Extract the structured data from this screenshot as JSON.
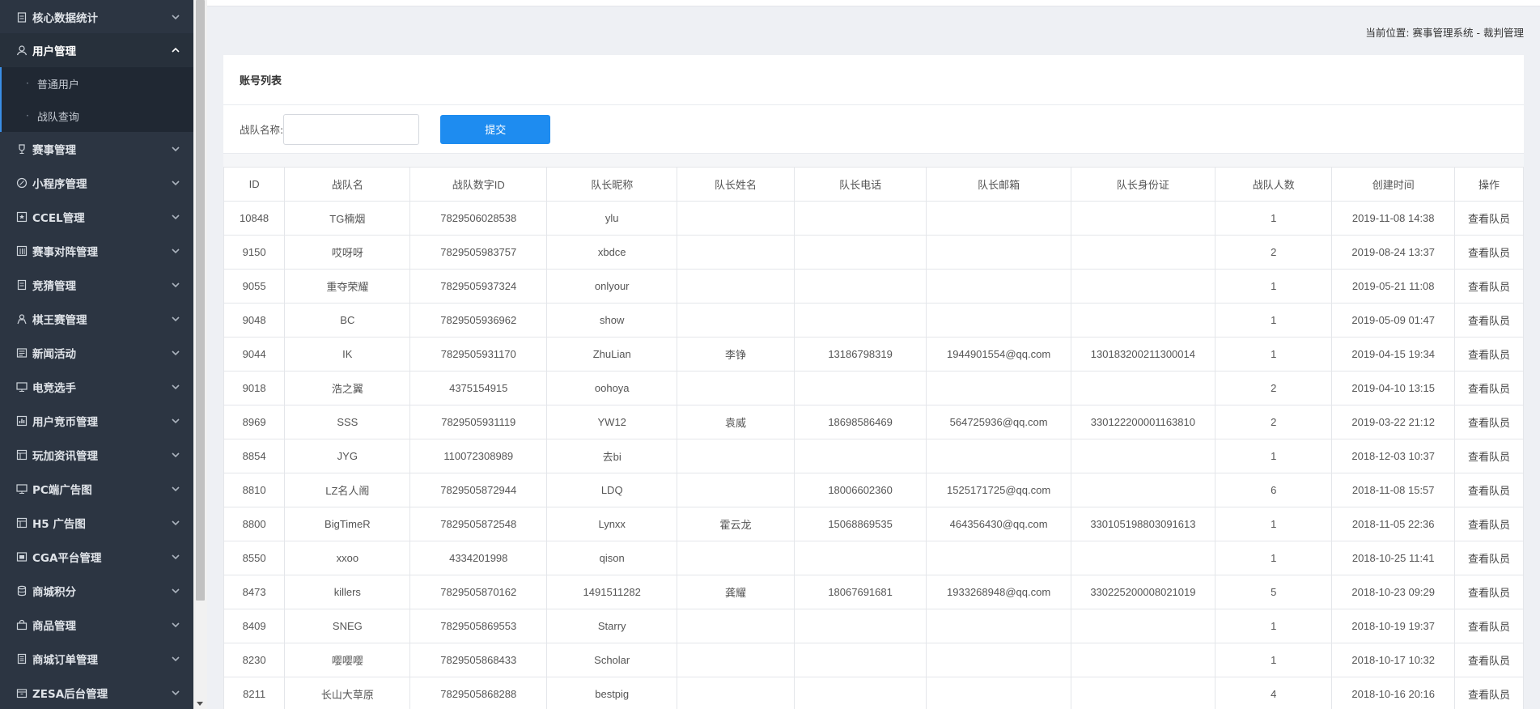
{
  "sidebar": {
    "items": [
      {
        "label": "核心数据统计",
        "icon": "clipboard-icon",
        "open": false
      },
      {
        "label": "用户管理",
        "icon": "user-icon",
        "open": true,
        "children": [
          "普通用户",
          "战队查询"
        ]
      },
      {
        "label": "赛事管理",
        "icon": "trophy-icon",
        "open": false
      },
      {
        "label": "小程序管理",
        "icon": "link-icon",
        "open": false
      },
      {
        "label": "CCEL管理",
        "icon": "star-box-icon",
        "open": false
      },
      {
        "label": "赛事对阵管理",
        "icon": "grid-icon",
        "open": false
      },
      {
        "label": "竞猜管理",
        "icon": "document-icon",
        "open": false
      },
      {
        "label": "棋王赛管理",
        "icon": "person-icon",
        "open": false
      },
      {
        "label": "新闻活动",
        "icon": "news-icon",
        "open": false
      },
      {
        "label": "电竞选手",
        "icon": "monitor-icon",
        "open": false
      },
      {
        "label": "用户竞币管理",
        "icon": "chart-icon",
        "open": false
      },
      {
        "label": "玩加资讯管理",
        "icon": "panel-icon",
        "open": false
      },
      {
        "label": "PC端广告图",
        "icon": "monitor-icon",
        "open": false
      },
      {
        "label": "H5 广告图",
        "icon": "panel-icon",
        "open": false
      },
      {
        "label": "CGA平台管理",
        "icon": "window-icon",
        "open": false
      },
      {
        "label": "商城积分",
        "icon": "database-icon",
        "open": false
      },
      {
        "label": "商品管理",
        "icon": "bag-icon",
        "open": false
      },
      {
        "label": "商城订单管理",
        "icon": "list-icon",
        "open": false
      },
      {
        "label": "ZESA后台管理",
        "icon": "box-icon",
        "open": false
      }
    ]
  },
  "breadcrumb": "当前位置: 赛事管理系统 - 裁判管理",
  "panel": {
    "title": "账号列表",
    "search_label": "战队名称:",
    "search_value": "",
    "submit_label": "提交"
  },
  "table": {
    "columns": [
      "ID",
      "战队名",
      "战队数字ID",
      "队长昵称",
      "队长姓名",
      "队长电话",
      "队长邮箱",
      "队长身份证",
      "战队人数",
      "创建时间",
      "操作"
    ],
    "rows": [
      [
        "10848",
        "TG楠烟",
        "7829506028538",
        "ylu",
        "",
        "",
        "",
        "",
        "1",
        "2019-11-08 14:38",
        "查看队员"
      ],
      [
        "9150",
        "哎呀呀",
        "7829505983757",
        "xbdce",
        "",
        "",
        "",
        "",
        "2",
        "2019-08-24 13:37",
        "查看队员"
      ],
      [
        "9055",
        "重夺荣耀",
        "7829505937324",
        "onlyour",
        "",
        "",
        "",
        "",
        "1",
        "2019-05-21 11:08",
        "查看队员"
      ],
      [
        "9048",
        "BC",
        "7829505936962",
        "show",
        "",
        "",
        "",
        "",
        "1",
        "2019-05-09 01:47",
        "查看队员"
      ],
      [
        "9044",
        "IK",
        "7829505931170",
        "ZhuLian",
        "李铮",
        "13186798319",
        "1944901554@qq.com",
        "130183200211300014",
        "1",
        "2019-04-15 19:34",
        "查看队员"
      ],
      [
        "9018",
        "浩之翼",
        "4375154915",
        "oohoya",
        "",
        "",
        "",
        "",
        "2",
        "2019-04-10 13:15",
        "查看队员"
      ],
      [
        "8969",
        "SSS",
        "7829505931119",
        "YW12",
        "袁威",
        "18698586469",
        "564725936@qq.com",
        "330122200001163810",
        "2",
        "2019-03-22 21:12",
        "查看队员"
      ],
      [
        "8854",
        "JYG",
        "110072308989",
        "去bi",
        "",
        "",
        "",
        "",
        "1",
        "2018-12-03 10:37",
        "查看队员"
      ],
      [
        "8810",
        "LZ名人阁",
        "7829505872944",
        "LDQ",
        "",
        "18006602360",
        "1525171725@qq.com",
        "",
        "6",
        "2018-11-08 15:57",
        "查看队员"
      ],
      [
        "8800",
        "BigTimeR",
        "7829505872548",
        "Lynxx",
        "霍云龙",
        "15068869535",
        "464356430@qq.com",
        "330105198803091613",
        "1",
        "2018-11-05 22:36",
        "查看队员"
      ],
      [
        "8550",
        "xxoo",
        "4334201998",
        "qison",
        "",
        "",
        "",
        "",
        "1",
        "2018-10-25 11:41",
        "查看队员"
      ],
      [
        "8473",
        "killers",
        "7829505870162",
        "1491511282",
        "龚耀",
        "18067691681",
        "1933268948@qq.com",
        "330225200008021019",
        "5",
        "2018-10-23 09:29",
        "查看队员"
      ],
      [
        "8409",
        "SNEG",
        "7829505869553",
        "Starry",
        "",
        "",
        "",
        "",
        "1",
        "2018-10-19 19:37",
        "查看队员"
      ],
      [
        "8230",
        "嘤嘤嘤",
        "7829505868433",
        "Scholar",
        "",
        "",
        "",
        "",
        "1",
        "2018-10-17 10:32",
        "查看队员"
      ],
      [
        "8211",
        "长山大草原",
        "7829505868288",
        "bestpig",
        "",
        "",
        "",
        "",
        "4",
        "2018-10-16 20:16",
        "查看队员"
      ]
    ]
  }
}
